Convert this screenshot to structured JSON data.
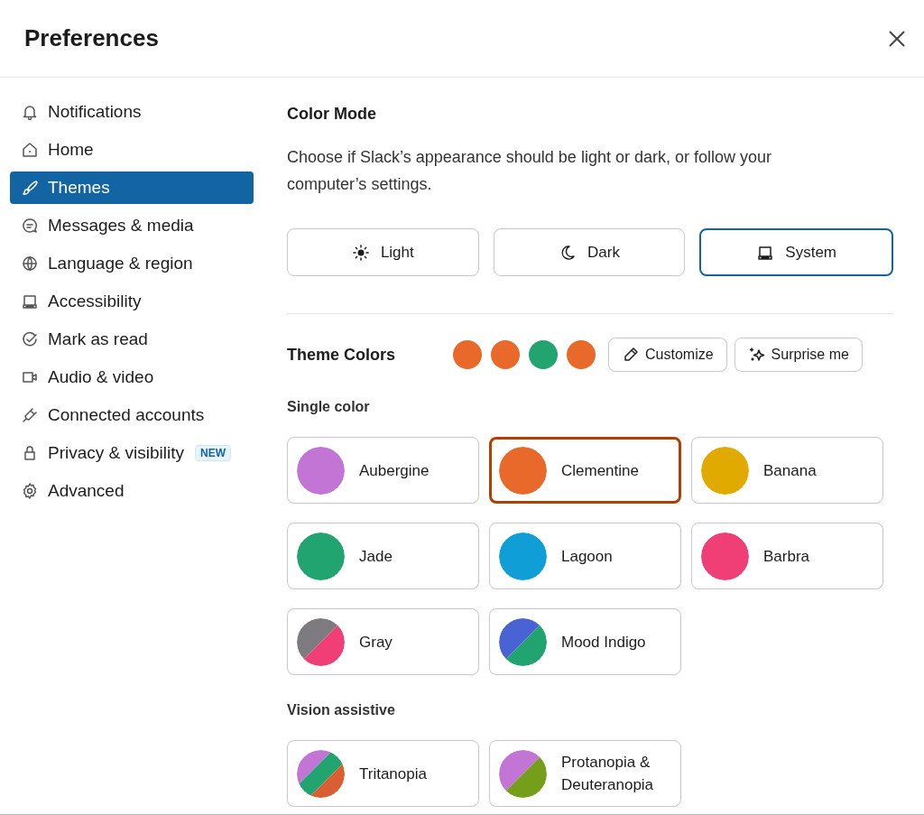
{
  "window": {
    "title": "Preferences"
  },
  "sidebar": {
    "items": [
      {
        "label": "Notifications",
        "selected": false
      },
      {
        "label": "Home",
        "selected": false
      },
      {
        "label": "Themes",
        "selected": true
      },
      {
        "label": "Messages & media",
        "selected": false
      },
      {
        "label": "Language & region",
        "selected": false
      },
      {
        "label": "Accessibility",
        "selected": false
      },
      {
        "label": "Mark as read",
        "selected": false
      },
      {
        "label": "Audio & video",
        "selected": false
      },
      {
        "label": "Connected accounts",
        "selected": false
      },
      {
        "label": "Privacy & visibility",
        "selected": false,
        "badge": "NEW"
      },
      {
        "label": "Advanced",
        "selected": false
      }
    ]
  },
  "color_mode": {
    "heading": "Color Mode",
    "description": "Choose if Slack’s appearance should be light or dark, or follow your computer’s settings.",
    "options": [
      {
        "label": "Light",
        "selected": false
      },
      {
        "label": "Dark",
        "selected": false
      },
      {
        "label": "System",
        "selected": true
      }
    ]
  },
  "theme_colors": {
    "heading": "Theme Colors",
    "dots": [
      {
        "color": "#e8692a"
      },
      {
        "color": "#e8692a"
      },
      {
        "color": "#21a46f"
      },
      {
        "color": "#e8692a"
      }
    ],
    "buttons": [
      "Customize",
      "Surprise me"
    ],
    "groups": [
      {
        "label": "Single color",
        "themes": [
          {
            "name": "Aubergine",
            "selected": false,
            "colors": [
              {
                "color": "#c275d4"
              }
            ]
          },
          {
            "name": "Clementine",
            "selected": true,
            "colors": [
              {
                "color": "#e8692a"
              }
            ]
          },
          {
            "name": "Banana",
            "selected": false,
            "colors": [
              {
                "color": "#e0aa00"
              }
            ]
          },
          {
            "name": "Jade",
            "selected": false,
            "colors": [
              {
                "color": "#21a46f"
              }
            ]
          },
          {
            "name": "Lagoon",
            "selected": false,
            "colors": [
              {
                "color": "#0f9fd6"
              }
            ]
          },
          {
            "name": "Barbra",
            "selected": false,
            "colors": [
              {
                "color": "#ef3f76"
              }
            ]
          },
          {
            "name": "Gray",
            "selected": false,
            "colors": [
              {
                "color": "#7d7b80"
              },
              {
                "color": "#ef3f76"
              }
            ]
          },
          {
            "name": "Mood Indigo",
            "selected": false,
            "colors": [
              {
                "color": "#4a63d4"
              },
              {
                "color": "#21a46f"
              }
            ]
          }
        ]
      },
      {
        "label": "Vision assistive",
        "themes": [
          {
            "name": "Tritanopia",
            "selected": false,
            "colors": [
              {
                "color": "#c275d4"
              },
              {
                "color": "#21a46f"
              },
              {
                "color": "#d95f32"
              }
            ]
          },
          {
            "name": "Protanopia & Deuteranopia",
            "selected": false,
            "colors": [
              {
                "color": "#c275d4"
              },
              {
                "color": "#759e1b"
              }
            ]
          }
        ]
      }
    ]
  }
}
